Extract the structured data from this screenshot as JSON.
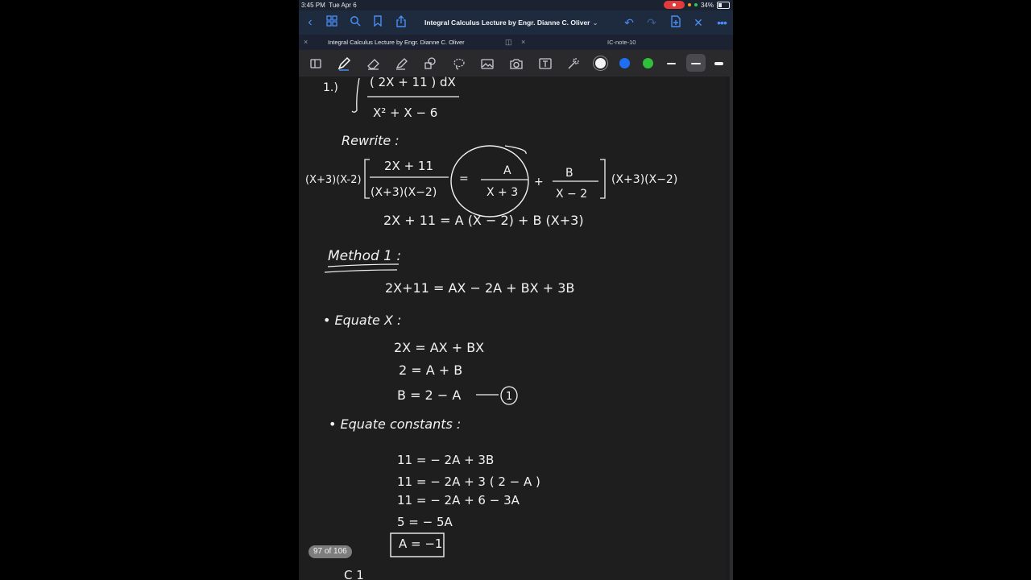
{
  "status": {
    "time": "3:45 PM",
    "date": "Tue Apr 6",
    "battery": "34%"
  },
  "navbar": {
    "title": "Integral Calculus Lecture by Engr. Dianne C. Oliver",
    "accent": "#4a8ef3"
  },
  "tabs": [
    {
      "label": "Integral Calculus Lecture by Engr. Dianne C. Oliver",
      "active": true
    },
    {
      "label": "IC-note-10",
      "active": false
    }
  ],
  "toolbar": {
    "tools": [
      "sidebar-toggle-icon",
      "pen-icon",
      "eraser-icon",
      "highlighter-icon",
      "shapes-icon",
      "lasso-icon",
      "image-icon",
      "camera-icon",
      "text-icon",
      "laser-pointer-icon"
    ],
    "colors": [
      "#f4f4f4",
      "#1f6ff5",
      "#2fbf3a"
    ],
    "stroke_sizes": [
      "thin",
      "medium",
      "thick"
    ],
    "selected_stroke": "medium"
  },
  "notes": {
    "problem": "1.)",
    "numerator": "( 2X + 11 ) dX",
    "denominator": "X² + X − 6",
    "rewrite": "Rewrite :",
    "lhs_factor": "(X+3)(X-2)",
    "frac1_num": "2X + 11",
    "frac1_den": "(X+3)(X−2)",
    "eq1": "=",
    "frac2_num": "A",
    "frac2_den": "X + 3",
    "plus": "+",
    "frac3_num": "B",
    "frac3_den": "X − 2",
    "rhs_factor": "(X+3)(X−2)",
    "expansion": "2X + 11   =  A (X − 2)  +  B (X+3)",
    "method_heading": "Method 1 :",
    "method_line": "2X+11 = AX − 2A  + BX + 3B",
    "equate_x": "• Equate X :",
    "ex1": "2X  =  AX  + BX",
    "ex2": "2  =  A + B",
    "ex3": "B  =  2 − A",
    "ex3_tag": "1",
    "equate_c": "• Equate constants :",
    "c1": "11  =  − 2A  + 3B",
    "c2": "11  =  − 2A + 3 ( 2 − A )",
    "c3": "11  =  − 2A  + 6 − 3A",
    "c4": "5  =  − 5A",
    "c5": "A = −1",
    "partial": "C  1"
  },
  "page_indicator": "97 of 106"
}
